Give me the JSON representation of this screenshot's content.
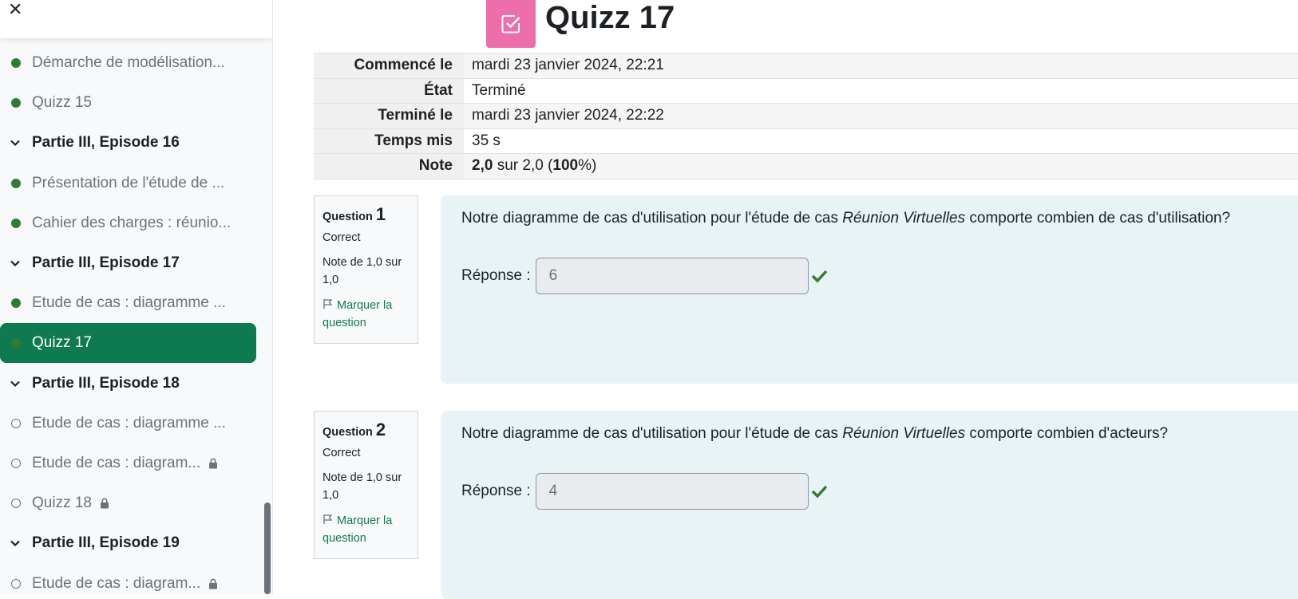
{
  "sidebar": {
    "close_label": "✕",
    "items": [
      {
        "label": "Démarche de modélisation...",
        "kind": "activity",
        "status": "done"
      },
      {
        "label": "Quizz 15",
        "kind": "activity",
        "status": "done"
      },
      {
        "label": "Partie III, Episode 16",
        "kind": "section"
      },
      {
        "label": "Présentation de l'étude de ...",
        "kind": "activity",
        "status": "done"
      },
      {
        "label": "Cahier des charges : réunio...",
        "kind": "activity",
        "status": "done"
      },
      {
        "label": "Partie III, Episode 17",
        "kind": "section"
      },
      {
        "label": "Etude de cas : diagramme ...",
        "kind": "activity",
        "status": "done"
      },
      {
        "label": "Quizz 17",
        "kind": "activity",
        "status": "done",
        "active": true
      },
      {
        "label": "Partie III, Episode 18",
        "kind": "section"
      },
      {
        "label": "Etude de cas : diagramme ...",
        "kind": "activity",
        "status": "todo"
      },
      {
        "label": "Etude de cas : diagram...",
        "kind": "activity",
        "status": "todo",
        "locked": true
      },
      {
        "label": "Quizz 18",
        "kind": "activity",
        "status": "todo",
        "locked": true
      },
      {
        "label": "Partie III, Episode 19",
        "kind": "section"
      },
      {
        "label": "Etude de cas : diagram...",
        "kind": "activity",
        "status": "todo",
        "locked": true
      }
    ]
  },
  "header": {
    "title": "Quizz 17",
    "icon": "quiz-check-icon",
    "icon_color": "#ee6eab"
  },
  "summary": {
    "started_label": "Commencé le",
    "started_value": "mardi 23 janvier 2024, 22:21",
    "state_label": "État",
    "state_value": "Terminé",
    "finished_label": "Terminé le",
    "finished_value": "mardi 23 janvier 2024, 22:22",
    "time_label": "Temps mis",
    "time_value": "35 s",
    "grade_label": "Note",
    "grade_score": "2,0",
    "grade_mid": " sur 2,0 (",
    "grade_percent": "100",
    "grade_end": "%)"
  },
  "questions": [
    {
      "label": "Question",
      "number": "1",
      "state": "Correct",
      "grade": "Note de 1,0 sur 1,0",
      "flag_label": "Marquer la question",
      "text_before": "Notre diagramme de cas d'utilisation pour l'étude de cas ",
      "text_italic": "Réunion Virtuelles",
      "text_after": " comporte combien de cas d'utilisation?",
      "answer_label": "Réponse :",
      "answer_value": "6"
    },
    {
      "label": "Question",
      "number": "2",
      "state": "Correct",
      "grade": "Note de 1,0 sur 1,0",
      "flag_label": "Marquer la question",
      "text_before": "Notre diagramme de cas d'utilisation pour l'étude de cas ",
      "text_italic": "Réunion Virtuelles",
      "text_after": " comporte combien d'acteurs?",
      "answer_label": "Réponse :",
      "answer_value": "4"
    }
  ],
  "colors": {
    "accent": "#0f7a52",
    "done_dot": "#357a32",
    "question_bg": "#e7f3f5",
    "check": "#357a32"
  }
}
